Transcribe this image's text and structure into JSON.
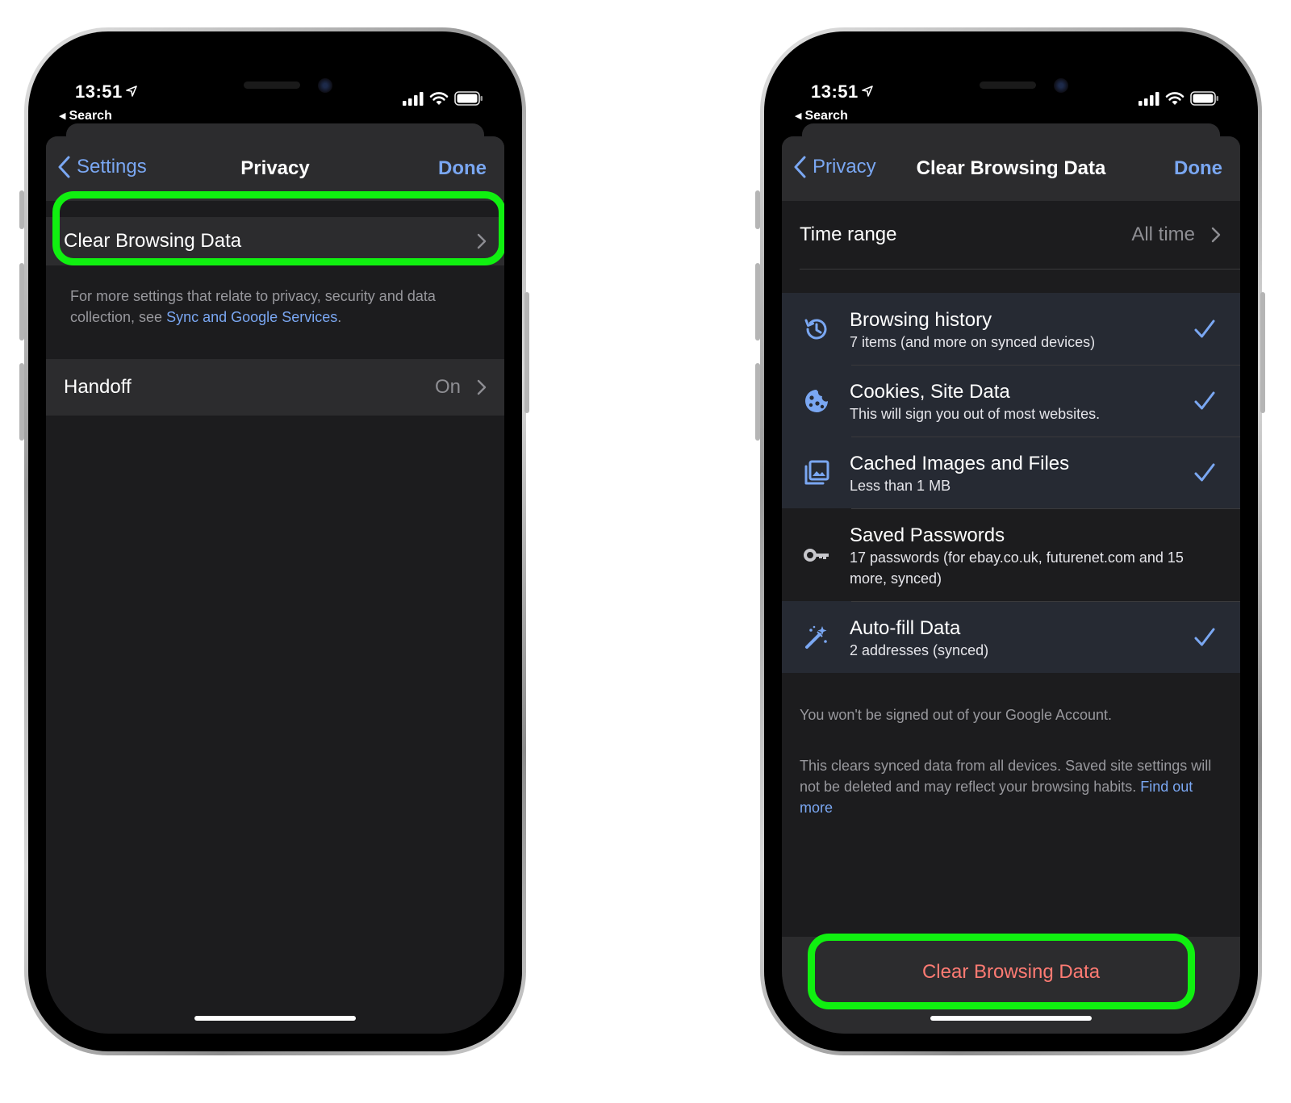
{
  "status_bar": {
    "time": "13:51",
    "back_app": "Search"
  },
  "privacy_screen": {
    "back_label": "Settings",
    "title": "Privacy",
    "done_label": "Done",
    "clear_browsing_data_label": "Clear Browsing Data",
    "footer_text": "For more settings that relate to privacy, security and data collection, see",
    "footer_link": "Sync and Google Services",
    "footer_end": ".",
    "handoff_label": "Handoff",
    "handoff_value": "On"
  },
  "clear_screen": {
    "back_label": "Privacy",
    "title": "Clear Browsing Data",
    "done_label": "Done",
    "time_range_label": "Time range",
    "time_range_value": "All time",
    "options": [
      {
        "icon": "history-icon",
        "label": "Browsing history",
        "detail": "7 items (and more on synced devices)",
        "checked": true
      },
      {
        "icon": "cookie-icon",
        "label": "Cookies, Site Data",
        "detail": "This will sign you out of most websites.",
        "checked": true
      },
      {
        "icon": "images-icon",
        "label": "Cached Images and Files",
        "detail": "Less than 1 MB",
        "checked": true
      },
      {
        "icon": "key-icon",
        "label": "Saved Passwords",
        "detail": "17 passwords (for ebay.co.uk, futurenet.com and 15 more, synced)",
        "checked": false
      },
      {
        "icon": "magic-wand-icon",
        "label": "Auto-fill Data",
        "detail": "2 addresses (synced)",
        "checked": true
      }
    ],
    "note_signed_out": "You won't be signed out of your Google Account.",
    "note_synced": "This clears synced data from all devices. Saved site settings will not be deleted and may reflect your browsing habits.",
    "find_out_more": "Find out more",
    "clear_button_label": "Clear Browsing Data"
  },
  "colors": {
    "accent_blue": "#7aa7f2",
    "destructive_red": "#ff7b73",
    "highlight_green": "#10f010",
    "sheet_background": "#1c1c1e",
    "cell_background": "#2c2c2e"
  }
}
